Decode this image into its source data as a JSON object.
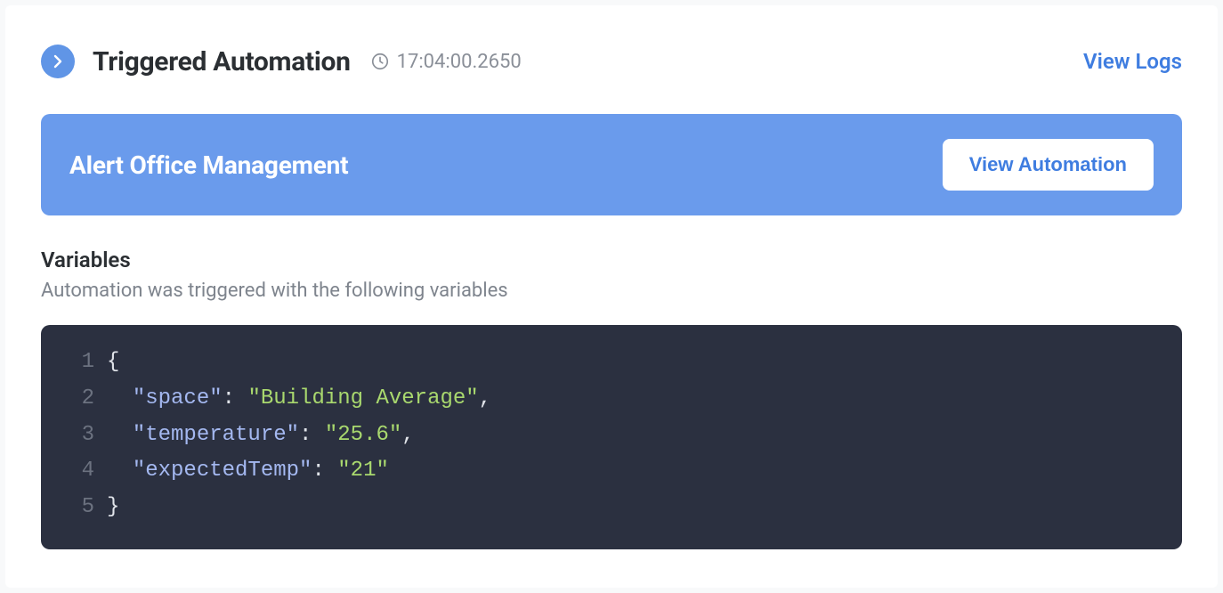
{
  "header": {
    "title": "Triggered Automation",
    "timestamp": "17:04:00.2650",
    "view_logs_label": "View Logs"
  },
  "automation": {
    "name": "Alert Office Management",
    "view_button_label": "View Automation"
  },
  "variables": {
    "title": "Variables",
    "subtitle": "Automation was triggered with the following variables",
    "code": {
      "lines": [
        {
          "num": "1",
          "tokens": [
            {
              "t": "brace",
              "v": "{"
            }
          ]
        },
        {
          "num": "2",
          "tokens": [
            {
              "t": "plain",
              "v": "  "
            },
            {
              "t": "key",
              "v": "\"space\""
            },
            {
              "t": "punct",
              "v": ": "
            },
            {
              "t": "str",
              "v": "\"Building Average\""
            },
            {
              "t": "punct",
              "v": ","
            }
          ]
        },
        {
          "num": "3",
          "tokens": [
            {
              "t": "plain",
              "v": "  "
            },
            {
              "t": "key",
              "v": "\"temperature\""
            },
            {
              "t": "punct",
              "v": ": "
            },
            {
              "t": "str",
              "v": "\"25.6\""
            },
            {
              "t": "punct",
              "v": ","
            }
          ]
        },
        {
          "num": "4",
          "tokens": [
            {
              "t": "plain",
              "v": "  "
            },
            {
              "t": "key",
              "v": "\"expectedTemp\""
            },
            {
              "t": "punct",
              "v": ": "
            },
            {
              "t": "str",
              "v": "\"21\""
            }
          ]
        },
        {
          "num": "5",
          "tokens": [
            {
              "t": "brace",
              "v": "}"
            }
          ]
        }
      ]
    }
  }
}
